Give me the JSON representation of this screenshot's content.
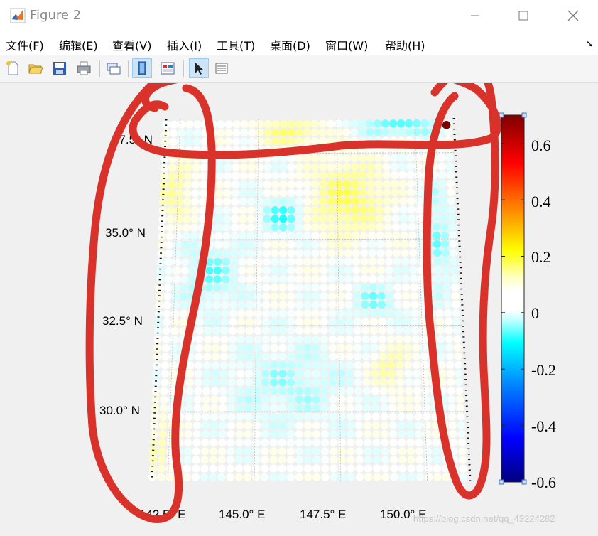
{
  "window": {
    "title": "Figure 2",
    "minimize_icon": "minimize-icon",
    "maximize_icon": "maximize-icon",
    "close_icon": "close-icon"
  },
  "menu": {
    "items": [
      "文件(F)",
      "编辑(E)",
      "查看(V)",
      "插入(I)",
      "工具(T)",
      "桌面(D)",
      "窗口(W)",
      "帮助(H)"
    ]
  },
  "toolbar": {
    "buttons": [
      "new-figure-icon",
      "open-file-icon",
      "save-icon",
      "print-icon",
      "link-plot-icon",
      "hide-plot-tools-icon",
      "show-plot-tools-icon",
      "edit-plot-arrow-icon",
      "insert-colorbar-icon"
    ]
  },
  "chart_data": {
    "type": "scatter",
    "title": "",
    "lat_ticks": [
      "37.5° N",
      "35.0° N",
      "32.5° N",
      "30.0° N"
    ],
    "lon_ticks": [
      "142.5° E",
      "145.0° E",
      "147.5° E",
      "150.0° E"
    ],
    "lat_range": [
      28.0,
      38.5
    ],
    "lon_range": [
      142.0,
      151.2
    ],
    "grid": true,
    "colorbar": {
      "ticks": [
        "0.6",
        "0.4",
        "0.2",
        "0",
        "-0.2",
        "-0.4",
        "-0.6"
      ],
      "tick_values": [
        0.6,
        0.4,
        0.2,
        0,
        -0.2,
        -0.4,
        -0.6
      ],
      "range": [
        -0.6,
        0.7
      ],
      "colormap": "jet-with-white-center"
    },
    "max_point": {
      "lat": 38.3,
      "lon": 151.0,
      "value": 0.7
    }
  },
  "watermark": "https://blog.csdn.net/qq_43224282",
  "colors": {
    "annotation": "#d9322a",
    "colorbar_handles": "#3a78c2"
  }
}
